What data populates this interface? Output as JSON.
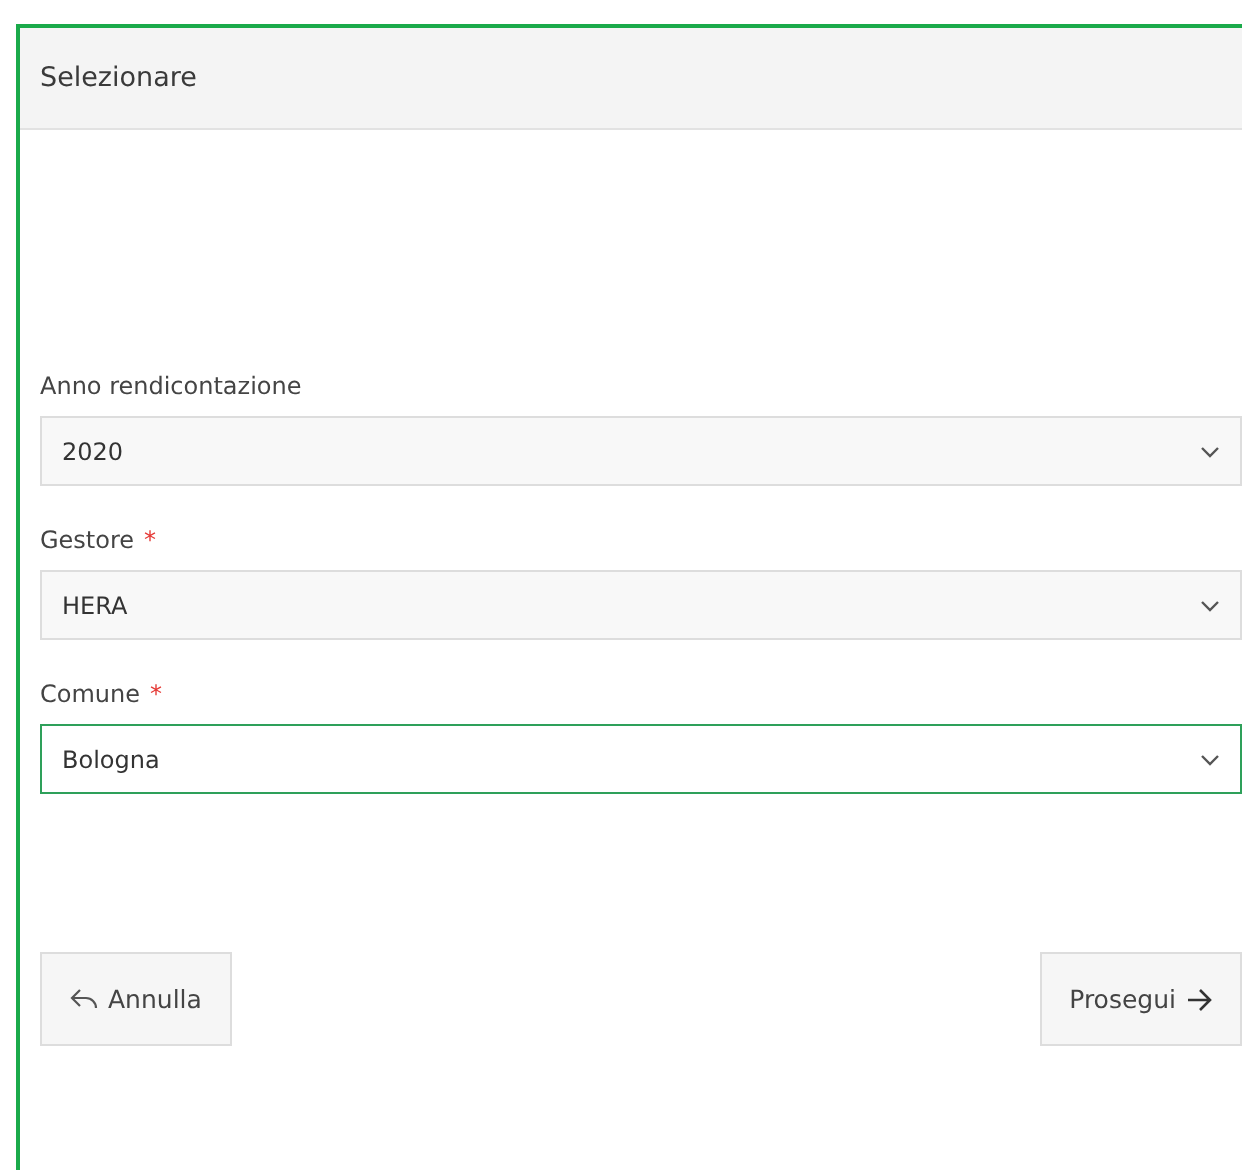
{
  "panel": {
    "title": "Selezionare"
  },
  "fields": [
    {
      "label": "Anno rendicontazione",
      "value": "2020",
      "focused": false
    },
    {
      "label": "Gestore",
      "required_mark": "*",
      "value": "HERA",
      "focused": false
    },
    {
      "label": "Comune",
      "required_mark": "*",
      "value": "Bologna",
      "focused": true
    }
  ],
  "buttons": [
    {
      "label": "Annulla",
      "kind": "back"
    },
    {
      "label": "Prosegui",
      "kind": "next"
    }
  ]
}
